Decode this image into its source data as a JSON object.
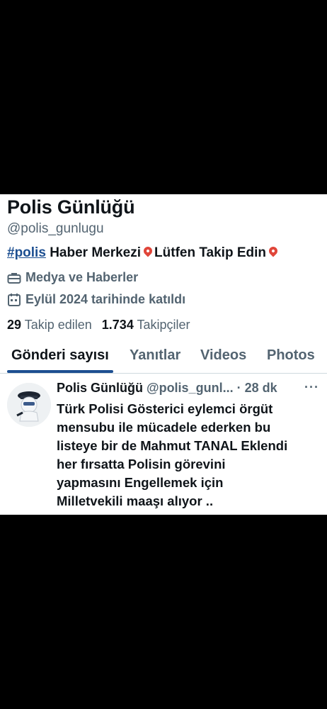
{
  "profile": {
    "name": "Polis Günlüğü",
    "handle": "@polis_gunlugu",
    "bio_hashtag": "#polis",
    "bio_text_1": "Haber Merkezi",
    "bio_text_2": "Lütfen Takip Edin",
    "category": "Medya ve Haberler",
    "joined": "Eylül 2024 tarihinde katıldı",
    "following_count": "29",
    "following_label": "Takip edilen",
    "followers_count": "1.734",
    "followers_label": "Takipçiler",
    "icons": [
      "briefcase-icon",
      "calendar-icon",
      "location-pin-icon"
    ]
  },
  "tabs": [
    {
      "label": "Gönderi sayısı",
      "active": true
    },
    {
      "label": "Yanıtlar",
      "active": false
    },
    {
      "label": "Videos",
      "active": false
    },
    {
      "label": "Photos",
      "active": false
    }
  ],
  "post": {
    "author": "Polis Günlüğü",
    "handle": "@polis_gunl...",
    "time": "· 28 dk",
    "more": "···",
    "lines": [
      "Türk Polisi Gösterici eylemci örgüt",
      "mensubu ile mücadele ederken bu",
      "listeye bir de Mahmut TANAL Eklendi",
      "her fırsatta Polisin görevini",
      "yapmasını Engellemek için",
      "Milletvekili maaşı alıyor .."
    ]
  },
  "colors": {
    "accent": "#1d4f91",
    "text": "#0f1419",
    "muted": "#536471",
    "pin": "#e0463a",
    "background": "#000000"
  }
}
